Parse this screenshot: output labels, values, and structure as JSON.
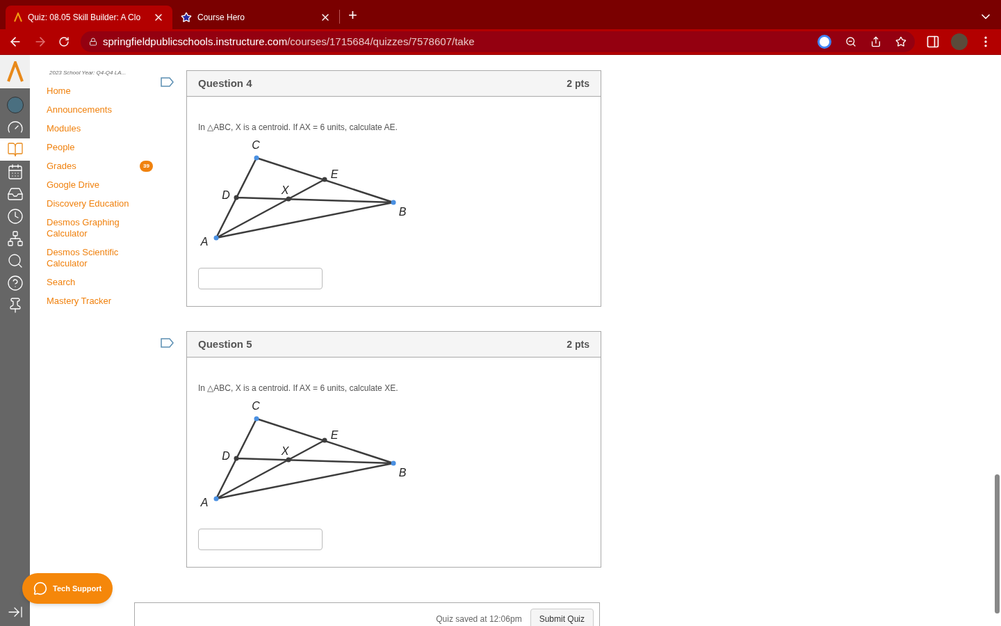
{
  "browser": {
    "tabs": [
      {
        "title": "Quiz: 08.05 Skill Builder: A Clo",
        "selected": true
      },
      {
        "title": "Course Hero",
        "selected": false
      }
    ],
    "new_tab": "+",
    "url": {
      "domain": "springfieldpublicschools.instructure.com",
      "path": "/courses/1715684/quizzes/7578607/take"
    }
  },
  "global_nav": {
    "items": [
      {
        "kind": "avatar",
        "selected": false
      },
      {
        "kind": "dashboard",
        "selected": false
      },
      {
        "kind": "courses",
        "selected": true
      },
      {
        "kind": "calendar",
        "selected": false
      },
      {
        "kind": "inbox",
        "selected": false
      },
      {
        "kind": "history",
        "selected": false
      },
      {
        "kind": "groups",
        "selected": false
      },
      {
        "kind": "search",
        "selected": false
      },
      {
        "kind": "help",
        "selected": false
      },
      {
        "kind": "pin",
        "selected": false
      }
    ]
  },
  "course_nav": {
    "term": "2023 School Year: Q4-Q4 LA...",
    "items": [
      {
        "label": "Home"
      },
      {
        "label": "Announcements"
      },
      {
        "label": "Modules"
      },
      {
        "label": "People"
      },
      {
        "label": "Grades",
        "badge": "39"
      },
      {
        "label": "Google Drive"
      },
      {
        "label": "Discovery Education"
      },
      {
        "label": "Desmos Graphing Calculator"
      },
      {
        "label": "Desmos Scientific Calculator"
      },
      {
        "label": "Search"
      },
      {
        "label": "Mastery Tracker"
      }
    ]
  },
  "questions": [
    {
      "title": "Question 4",
      "points": "2 pts",
      "flagged": false,
      "text": "In △ABC, X is a centroid. If AX = 6 units, calculate AE.",
      "labels": [
        "C",
        "E",
        "D",
        "X",
        "B",
        "A"
      ]
    },
    {
      "title": "Question 5",
      "points": "2 pts",
      "flagged": false,
      "text": "In △ABC, X is a centroid. If AX = 6 units, calculate XE.",
      "labels": [
        "C",
        "E",
        "D",
        "X",
        "B",
        "A"
      ]
    }
  ],
  "tech_support": "Tech Support",
  "footer": {
    "status": "Quiz saved at 12:06pm",
    "submit": "Submit Quiz"
  }
}
